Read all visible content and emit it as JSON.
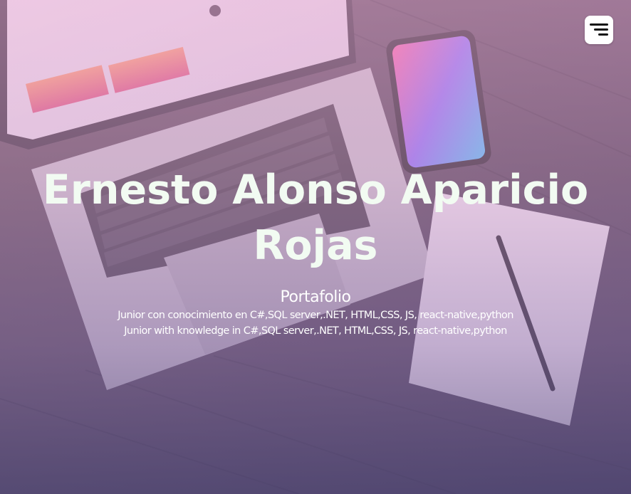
{
  "header": {
    "menu_icon": "hamburger-menu-icon"
  },
  "hero": {
    "name": "Ernesto Alonso Aparicio Rojas",
    "subtitle": "Portafolio",
    "description_es": "Junior con conocimiento en C#,SQL server,.NET, HTML,CSS, JS, react-native,python",
    "description_en": "Junior with knowledge in C#,SQL server,.NET, HTML,CSS, JS, react-native,python"
  },
  "colors": {
    "name_text": "#f2fbf2",
    "body_text": "#ffffff",
    "overlay_top": "#e8aad4",
    "overlay_bottom": "#5a5082",
    "menu_button_bg": "#ffffff"
  }
}
